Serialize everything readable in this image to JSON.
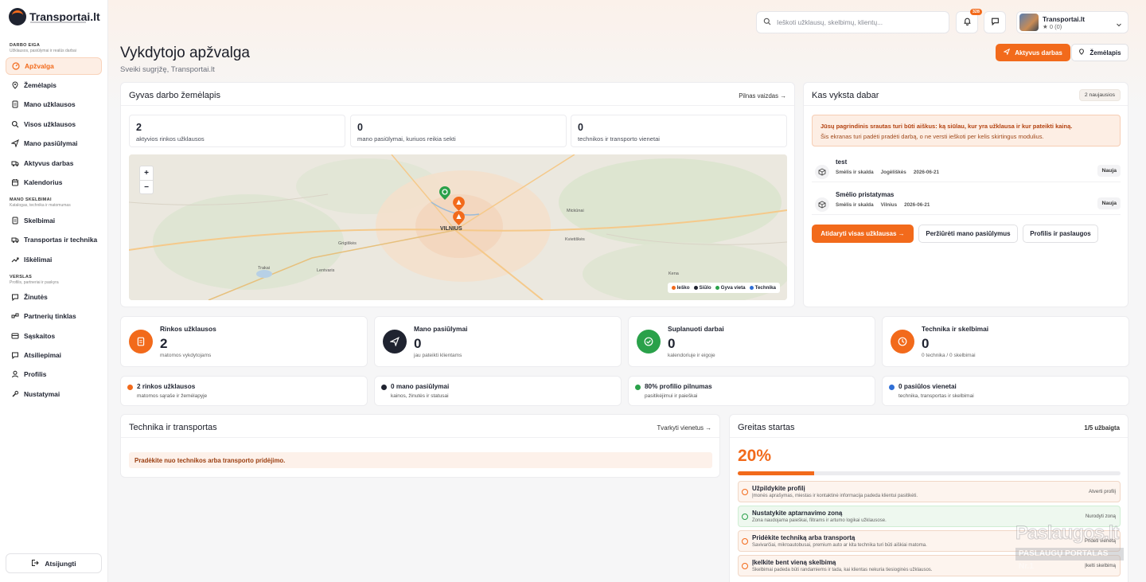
{
  "app": {
    "name": "Transportai.lt"
  },
  "sidebar": {
    "sections": [
      {
        "title": "DARBO EIGA",
        "subtitle": "Užklausos, pasiūlymai ir realūs darbai"
      },
      {
        "title": "MANO SKELBIMAI",
        "subtitle": "Katalogas, technika ir matomumas"
      },
      {
        "title": "VERSLAS",
        "subtitle": "Profilis, partneriai ir paskyra"
      }
    ],
    "items": [
      {
        "label": "Apžvalga",
        "icon": "gauge-icon",
        "active": true
      },
      {
        "label": "Žemėlapis",
        "icon": "map-pin-icon"
      },
      {
        "label": "Mano užklausos",
        "icon": "document-icon"
      },
      {
        "label": "Visos užklausos",
        "icon": "search-icon"
      },
      {
        "label": "Mano pasiūlymai",
        "icon": "send-icon"
      },
      {
        "label": "Aktyvus darbas",
        "icon": "truck-icon"
      },
      {
        "label": "Kalendorius",
        "icon": "calendar-icon"
      },
      {
        "label": "Skelbimai",
        "icon": "document-icon"
      },
      {
        "label": "Transportas ir technika",
        "icon": "truck-icon"
      },
      {
        "label": "Iškėlimai",
        "icon": "trend-up-icon"
      },
      {
        "label": "Žinutės",
        "icon": "chat-icon"
      },
      {
        "label": "Partnerių tinklas",
        "icon": "network-icon"
      },
      {
        "label": "Sąskaitos",
        "icon": "invoice-icon"
      },
      {
        "label": "Atsiliepimai",
        "icon": "chat-icon"
      },
      {
        "label": "Profilis",
        "icon": "user-icon"
      },
      {
        "label": "Nustatymai",
        "icon": "wrench-icon"
      }
    ],
    "logout": "Atsijungti"
  },
  "header": {
    "search_placeholder": "Ieškoti užklausų, skelbimų, klientų...",
    "notifications_count": "328",
    "profile_name": "Transportai.lt",
    "profile_rating": "0 (0)"
  },
  "page": {
    "title": "Vykdytojo apžvalga",
    "subtitle": "Sveiki sugrįžę, Transportai.lt",
    "btn_active": "Aktyvus darbas",
    "btn_map": "Žemėlapis"
  },
  "live_map": {
    "title": "Gyvas darbo žemėlapis",
    "link": "Pilnas vaizdas →",
    "stats": [
      {
        "value": "2",
        "label": "aktyvios rinkos užklausos"
      },
      {
        "value": "0",
        "label": "mano pasiūlymai, kuriuos reikia sekti"
      },
      {
        "value": "0",
        "label": "technikos ir transporto vienetai"
      }
    ],
    "city": "VILNIUS",
    "places": [
      "Mickūnai",
      "Kvietiškės",
      "Grigiškės",
      "Trakai",
      "Lentvaris",
      "Kena"
    ],
    "legend": [
      {
        "label": "Ieško",
        "color": "#f26a1b"
      },
      {
        "label": "Siūlo",
        "color": "#1f2330"
      },
      {
        "label": "Gyva vieta",
        "color": "#2aa14a"
      },
      {
        "label": "Technika",
        "color": "#2f6fd6"
      }
    ]
  },
  "now": {
    "title": "Kas vyksta dabar",
    "badge": "2 naujausios",
    "alert_title": "Jūsų pagrindinis srautas turi būti aiškus: ką siūlau, kur yra užklausa ir kur pateikti kainą.",
    "alert_text": "Šis ekranas turi padėti pradėti darbą, o ne versti ieškoti per kelis skirtingus modulius.",
    "requests": [
      {
        "title": "test",
        "category": "Smėlis ir skalda",
        "place": "Jogėliškės",
        "date": "2026-06-21",
        "status": "Nauja"
      },
      {
        "title": "Smėlio pristatymas",
        "category": "Smėlis ir skalda",
        "place": "Vilnius",
        "date": "2026-06-21",
        "status": "Nauja"
      }
    ],
    "btn_open": "Atidaryti visas užklausas →",
    "btn_offers": "Peržiūrėti mano pasiūlymus",
    "btn_profile": "Profilis ir paslaugos"
  },
  "kpis": [
    {
      "title": "Rinkos užklausos",
      "value": "2",
      "sub": "matomos vykdytojams",
      "icon": "document-icon",
      "color": "#f26a1b"
    },
    {
      "title": "Mano pasiūlymai",
      "value": "0",
      "sub": "jau pateikti klientams",
      "icon": "send-icon",
      "color": "#1f2330"
    },
    {
      "title": "Suplanuoti darbai",
      "value": "0",
      "sub": "kalendoriuje ir eigoje",
      "icon": "check-circle-icon",
      "color": "#2aa14a"
    },
    {
      "title": "Technika ir skelbimai",
      "value": "0",
      "sub": "0 technika / 0 skelbimai",
      "icon": "clock-icon",
      "color": "#f26a1b"
    }
  ],
  "mini_stats": [
    {
      "title": "2 rinkos užklausos",
      "sub": "matomos sąraše ir žemėlapyje",
      "color": "#f26a1b"
    },
    {
      "title": "0 mano pasiūlymai",
      "sub": "kainos, žinutės ir statusai",
      "color": "#1f2330"
    },
    {
      "title": "80% profilio pilnumas",
      "sub": "pasitikėjimui ir paieškai",
      "color": "#2aa14a"
    },
    {
      "title": "0 pasiūlos vienetai",
      "sub": "technika, transportas ir skelbimai",
      "color": "#2f6fd6"
    }
  ],
  "transport": {
    "title": "Technika ir transportas",
    "link": "Tvarkyti vienetus →",
    "empty": "Pradėkite nuo technikos arba transporto pridėjimo."
  },
  "quickstart": {
    "title": "Greitas startas",
    "badge": "1/5 užbaigta",
    "percent": "20%",
    "progress": 0.2,
    "tasks": [
      {
        "title": "Užpildykite profilį",
        "sub": "Įmonės aprašymas, miestas ir kontaktinė informacija padeda klientui pasitikėti.",
        "action": "Atverti profilį",
        "done": false
      },
      {
        "title": "Nustatykite aptarnavimo zoną",
        "sub": "Zona naudojama paieškai, filtrams ir artumo logikai užklausose.",
        "action": "Nurodyti zoną",
        "done": true
      },
      {
        "title": "Pridėkite techniką arba transportą",
        "sub": "Savivarčiai, mikroautobusai, premium auto ar kita technika turi būti aiškiai matoma.",
        "action": "Pridėti vienetą",
        "done": false
      },
      {
        "title": "Įkelkite bent vieną skelbimą",
        "sub": "Skelbimai padeda būti randamiems ir tada, kai klientas nekuria tiesioginės užklausos.",
        "action": "Įkelti skelbimą",
        "done": false
      }
    ]
  },
  "watermark": {
    "line1": "Paslaugos.lt",
    "line2": "PASLAUGŲ PORTALAS  Nr.1"
  }
}
